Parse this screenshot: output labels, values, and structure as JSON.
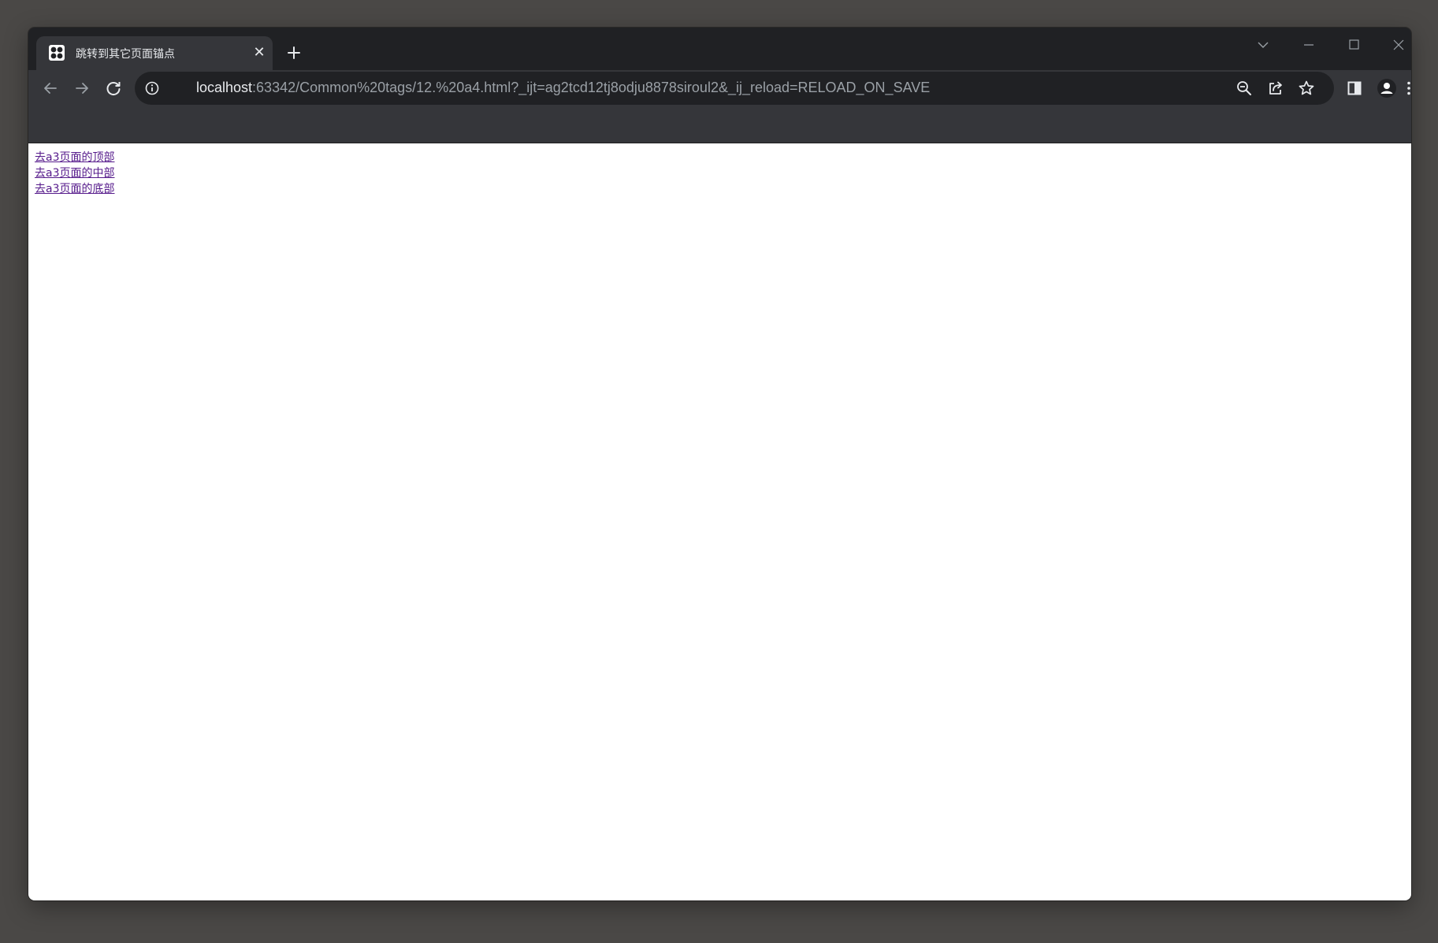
{
  "tab": {
    "title": "跳转到其它页面锚点",
    "close_glyph": "✕",
    "favicon": "grid-favicon-icon"
  },
  "toolbar": {
    "url_host": "localhost",
    "url_rest": ":63342/Common%20tags/12.%20a4.html?_ijt=ag2tcd12tj8odju8878siroul2&_ij_reload=RELOAD_ON_SAVE",
    "icons": [
      "back-icon",
      "forward-icon",
      "reload-icon",
      "info-icon",
      "zoom-out-icon",
      "share-icon",
      "star-icon",
      "side-panel-icon",
      "profile-icon",
      "menu-icon"
    ]
  },
  "page": {
    "links": [
      {
        "label": "去a3页面的顶部"
      },
      {
        "label": "去a3页面的中部"
      },
      {
        "label": "去a3页面的底部"
      }
    ],
    "link_color": "#551a8b"
  },
  "colors": {
    "frame": "#202124",
    "toolbar": "#35363a",
    "omnibox": "#202124"
  }
}
